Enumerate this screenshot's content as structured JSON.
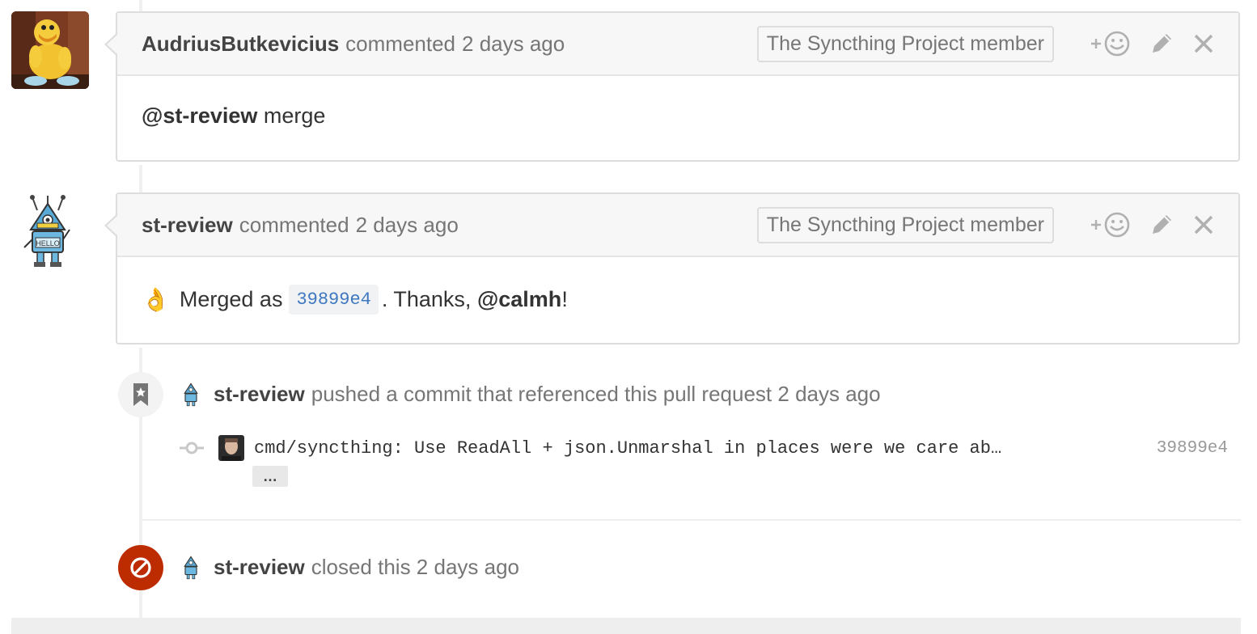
{
  "comments": [
    {
      "author": "AudriusButkevicius",
      "action": "commented",
      "time": "2 days ago",
      "badge": "The Syncthing Project member",
      "body": {
        "mention": "@st-review",
        "text": " merge"
      }
    },
    {
      "author": "st-review",
      "action": "commented",
      "time": "2 days ago",
      "badge": "The Syncthing Project member",
      "body": {
        "emoji": "👌",
        "pre": "Merged as",
        "sha": "39899e4",
        "mid": ". Thanks, ",
        "mention": "@calmh",
        "post": "!"
      }
    }
  ],
  "events": {
    "push": {
      "author": "st-review",
      "text": "pushed a commit that referenced this pull request 2 days ago",
      "commit_message": "cmd/syncthing: Use ReadAll + json.Unmarshal in places were we care ab…",
      "commit_sha": "39899e4",
      "expand_label": "…"
    },
    "closed": {
      "author": "st-review",
      "text": "closed this 2 days ago"
    }
  },
  "icons": {
    "add_reaction": "add-reaction-icon",
    "edit": "pencil-icon",
    "delete": "close-icon",
    "bookmark": "bookmark-icon",
    "commit": "git-commit-icon",
    "closed": "circle-slash-icon"
  },
  "colors": {
    "closed_badge": "#bd2c00",
    "link": "#4078c0"
  }
}
